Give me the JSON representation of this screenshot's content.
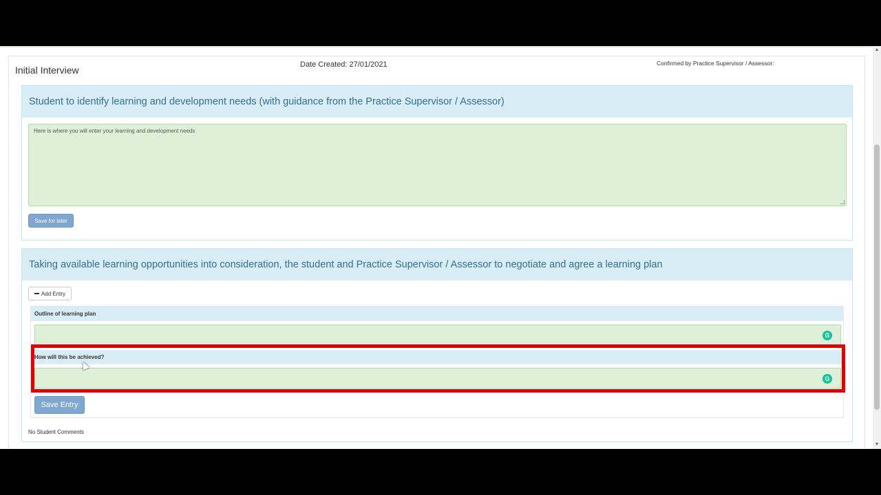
{
  "header": {
    "title": "Initial Interview",
    "date_created": "Date Created: 27/01/2021",
    "confirmed_by": "Confirmed by Practice Supervisor / Assessor:"
  },
  "needs_section": {
    "heading": "Student to identify learning and development needs (with guidance from the Practice Supervisor / Assessor)",
    "textarea_placeholder": "Here is where you will enter your learning and development needs",
    "save_label": "Save for later"
  },
  "plan_section": {
    "heading": "Taking available learning opportunities into consideration, the student and Practice Supervisor / Assessor to negotiate and agree a learning plan",
    "add_entry_label": "Add Entry",
    "outline_label": "Outline of learning plan",
    "achieve_label": "How will this be achieved?",
    "save_entry_label": "Save Entry",
    "comments_status": "No Student Comments"
  },
  "icons": {
    "grammarly": "grammarly-icon",
    "add_entry": "minus-icon"
  },
  "colors": {
    "highlight": "#e00000",
    "panel_heading_bg": "#d9edf7",
    "input_bg": "#dff0d8",
    "button_primary": "#7fa7cf"
  }
}
